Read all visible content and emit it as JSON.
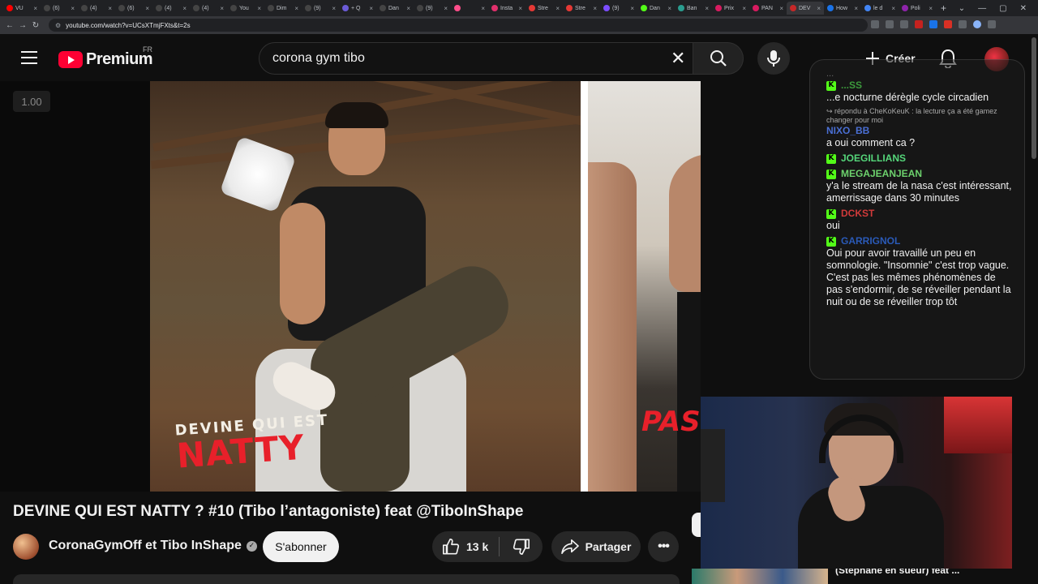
{
  "browser": {
    "tabs": [
      "VU",
      "(6)",
      "(4)",
      "(6)",
      "(4)",
      "(4)",
      "You",
      "Dim",
      "(9)",
      "+ Q",
      "Dan",
      "(9)",
      "",
      "Insta",
      "Stre",
      "Stre",
      "(9)",
      "Dan",
      "Ban",
      "Prix",
      "PAN",
      "DEV",
      "How",
      "le d",
      "Poli"
    ],
    "active_tab_index": 21,
    "url": "youtube.com/watch?v=UCsXTmjFXts&t=2s"
  },
  "header": {
    "logo": "Premium",
    "country": "FR",
    "search_value": "corona gym tibo",
    "create_label": "Créer"
  },
  "player": {
    "speed": "1.00",
    "overlay_small": "DEVINE QUI EST",
    "overlay_big": "NATTY",
    "overlay_right": "PAS"
  },
  "chat": {
    "faded_top": "...",
    "messages": [
      {
        "user": "...SS",
        "color": "#3c9a3c",
        "text": "...e nocturne dérègle cycle circadien",
        "badge": true,
        "reply": ""
      },
      {
        "user": "NIXO_BB",
        "color": "#4a6fd4",
        "text": "a oui comment ca ?",
        "badge": false,
        "reply": "↪ répondu à CheKoKeuK : la lecture ça a été gamez changer pour moi"
      },
      {
        "user": "JOEGILLIANS",
        "color": "#55d67a",
        "text": "",
        "badge": true,
        "reply": ""
      },
      {
        "user": "MEGAJEANJEAN",
        "color": "#6dd26d",
        "text": "y'a le stream de la nasa c'est intéressant, amerrissage dans 30 minutes",
        "badge": true,
        "reply": ""
      },
      {
        "user": "DCKST",
        "color": "#d03a3a",
        "text": "oui",
        "badge": true,
        "reply": ""
      },
      {
        "user": "GARRIGNOL",
        "color": "#2a5ab8",
        "text": "Oui pour avoir travaillé un peu en somnologie. \"Insomnie\" c'est trop vague. C'est pas les mêmes phénomènes de pas s'endormir, de se réveiller pendant la nuit ou de se réveiller trop tôt",
        "badge": true,
        "reply": ""
      }
    ]
  },
  "video": {
    "title": "DEVINE QUI EST NATTY ? #10 (Tibo l’antagoniste) feat @TiboInShape",
    "channel": "CoronaGymOff et Tibo InShape",
    "subscribe_label": "S'abonner",
    "likes": "13 k",
    "share_label": "Partager"
  },
  "up_next": {
    "title": "(Stéphane en sueur) feat ..."
  },
  "icons": {
    "menu": "hamburger-icon",
    "search": "search-icon",
    "mic": "mic-icon",
    "create": "plus-icon",
    "bell": "bell-icon",
    "like": "thumbs-up-icon",
    "dislike": "thumbs-down-icon",
    "share": "share-icon",
    "more": "more-icon",
    "verified": "verified-icon"
  },
  "colors": {
    "youtube_red": "#ff0033",
    "kick_green": "#53fc18",
    "overlay_red": "#e8202a"
  }
}
